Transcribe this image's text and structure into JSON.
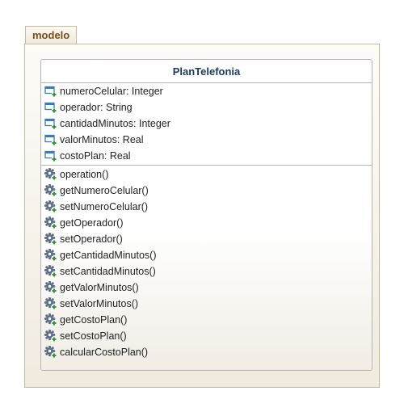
{
  "package": {
    "name": "modelo"
  },
  "class": {
    "name": "PlanTelefonia",
    "attributes": [
      {
        "label": "numeroCelular: Integer",
        "icon": "attribute-icon"
      },
      {
        "label": "operador: String",
        "icon": "attribute-icon"
      },
      {
        "label": "cantidadMinutos: Integer",
        "icon": "attribute-icon"
      },
      {
        "label": "valorMinutos: Real",
        "icon": "attribute-icon"
      },
      {
        "label": "costoPlan: Real",
        "icon": "attribute-icon"
      }
    ],
    "operations": [
      {
        "label": "operation()",
        "icon": "operation-icon"
      },
      {
        "label": "getNumeroCelular()",
        "icon": "operation-icon"
      },
      {
        "label": "setNumeroCelular()",
        "icon": "operation-icon"
      },
      {
        "label": "getOperador()",
        "icon": "operation-icon"
      },
      {
        "label": "setOperador()",
        "icon": "operation-icon"
      },
      {
        "label": "getCantidadMinutos()",
        "icon": "operation-icon"
      },
      {
        "label": "setCantidadMinutos()",
        "icon": "operation-icon"
      },
      {
        "label": "getValorMinutos()",
        "icon": "operation-icon"
      },
      {
        "label": "setValorMinutos()",
        "icon": "operation-icon"
      },
      {
        "label": "getCostoPlan()",
        "icon": "operation-icon"
      },
      {
        "label": "setCostoPlan()",
        "icon": "operation-icon"
      },
      {
        "label": "calcularCostoPlan()",
        "icon": "operation-icon"
      }
    ]
  },
  "colors": {
    "package_label": "#7a4e18",
    "class_name": "#1b3a63",
    "attribute_icon": "#3a7bbf",
    "plus_badge": "#2e9a2e",
    "gear": "#5b6f8a"
  }
}
